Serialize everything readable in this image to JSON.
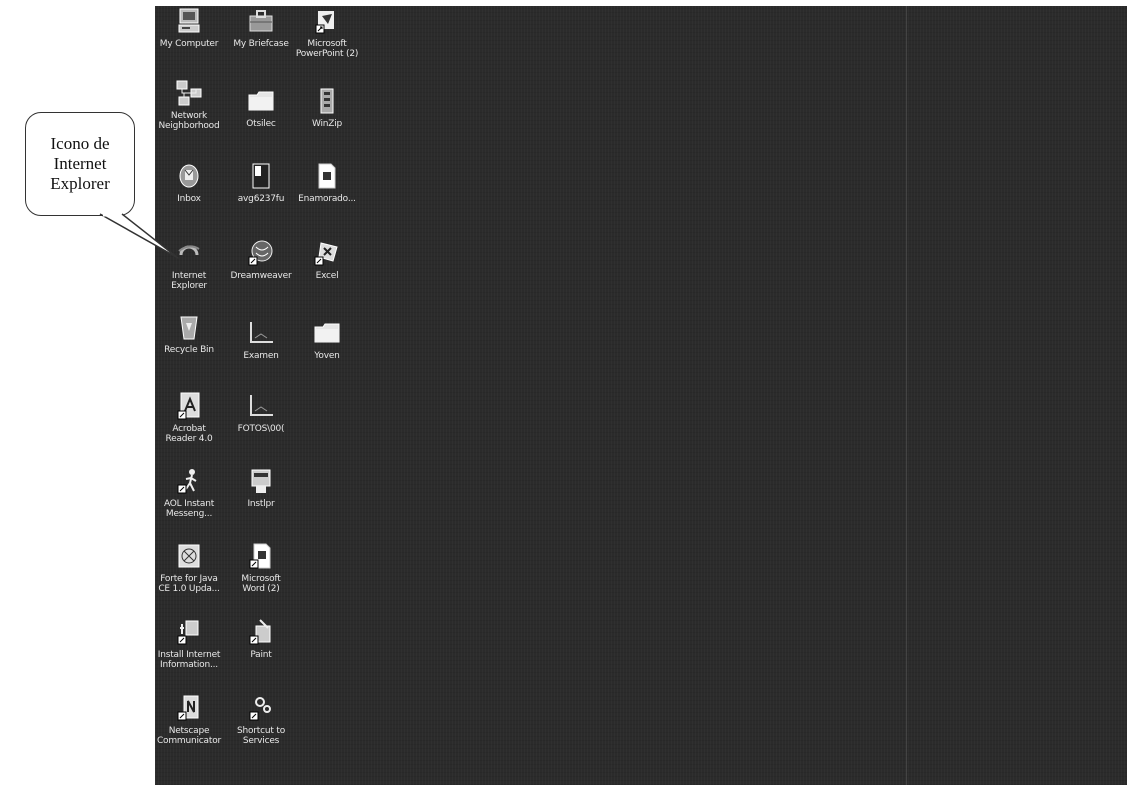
{
  "annotation": {
    "text": "Icono de\nInternet\nExplorer"
  },
  "desktop": {
    "icons": [
      {
        "label": "My Computer",
        "icon": "my-computer-icon"
      },
      {
        "label": "My Briefcase",
        "icon": "briefcase-icon"
      },
      {
        "label": "Microsoft\nPowerPoint (2)",
        "icon": "powerpoint-shortcut-icon"
      },
      {
        "label": "Network\nNeighborhood",
        "icon": "network-neighborhood-icon"
      },
      {
        "label": "Otsilec",
        "icon": "folder-icon"
      },
      {
        "label": "WinZip",
        "icon": "winzip-icon"
      },
      {
        "label": "Inbox",
        "icon": "inbox-icon"
      },
      {
        "label": "avg6237fu",
        "icon": "installer-file-icon"
      },
      {
        "label": "Enamorado...",
        "icon": "document-file-icon"
      },
      {
        "label": "Internet\nExplorer",
        "icon": "internet-explorer-icon"
      },
      {
        "label": "Dreamweaver",
        "icon": "dreamweaver-shortcut-icon"
      },
      {
        "label": "Excel",
        "icon": "excel-shortcut-icon"
      },
      {
        "label": "Recycle Bin",
        "icon": "recycle-bin-icon"
      },
      {
        "label": "Examen",
        "icon": "image-file-icon"
      },
      {
        "label": "Yoven",
        "icon": "folder-icon"
      },
      {
        "label": "Acrobat\nReader 4.0",
        "icon": "acrobat-reader-shortcut-icon"
      },
      {
        "label": "FOTOS\\00(",
        "icon": "image-file-icon"
      },
      {
        "label": "AOL Instant\nMesseng...",
        "icon": "aim-shortcut-icon"
      },
      {
        "label": "Instlpr",
        "icon": "installer-program-icon"
      },
      {
        "label": "Forte for Java\nCE 1.0 Upda...",
        "icon": "forte-java-icon"
      },
      {
        "label": "Microsoft\nWord (2)",
        "icon": "word-shortcut-icon"
      },
      {
        "label": "Install Internet\nInformation...",
        "icon": "install-iis-shortcut-icon"
      },
      {
        "label": "Paint",
        "icon": "paint-shortcut-icon"
      },
      {
        "label": "Netscape\nCommunicator",
        "icon": "netscape-shortcut-icon"
      },
      {
        "label": "Shortcut to\nServices",
        "icon": "services-shortcut-icon"
      }
    ]
  }
}
